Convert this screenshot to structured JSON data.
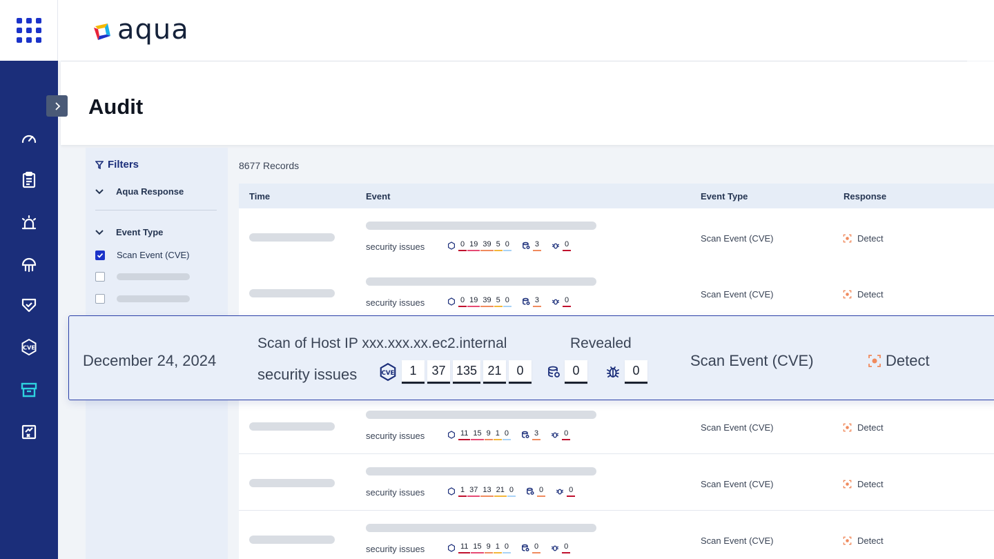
{
  "brand": {
    "name": "aqua"
  },
  "page": {
    "title": "Audit"
  },
  "nav": {
    "items": [
      {
        "name": "dashboard-icon"
      },
      {
        "name": "clipboard-icon"
      },
      {
        "name": "alarm-icon"
      },
      {
        "name": "jellyfish-icon"
      },
      {
        "name": "shield-check-icon"
      },
      {
        "name": "cve-icon"
      },
      {
        "name": "audit-icon",
        "active": true
      },
      {
        "name": "report-icon"
      }
    ],
    "active_color": "#2ed3e0",
    "color": "#ffffff",
    "background": "#1b2e7a"
  },
  "filters": {
    "title": "Filters",
    "groups": [
      {
        "label": "Aqua Response"
      },
      {
        "label": "Event Type"
      }
    ],
    "options": [
      {
        "label": "Scan Event (CVE)",
        "checked": true
      }
    ]
  },
  "records": {
    "count_label": "8677 Records"
  },
  "table": {
    "headers": {
      "time": "Time",
      "event": "Event",
      "event_type": "Event Type",
      "response": "Response"
    },
    "rows": [
      {
        "security_label": "security issues",
        "cve": [
          "0",
          "19",
          "39",
          "5",
          "0"
        ],
        "db": "3",
        "bug": "0",
        "event_type": "Scan Event (CVE)",
        "response": "Detect"
      },
      {
        "security_label": "security issues",
        "cve": [
          "0",
          "19",
          "39",
          "5",
          "0"
        ],
        "db": "3",
        "bug": "0",
        "event_type": "Scan Event (CVE)",
        "response": "Detect"
      },
      {
        "security_label": "security issues",
        "cve": [
          "11",
          "15",
          "9",
          "1",
          "0"
        ],
        "db": "3",
        "bug": "0",
        "event_type": "Scan Event (CVE)",
        "response": "Detect"
      },
      {
        "security_label": "security issues",
        "cve": [
          "1",
          "37",
          "13",
          "21",
          "0"
        ],
        "db": "0",
        "bug": "0",
        "event_type": "Scan Event (CVE)",
        "response": "Detect"
      },
      {
        "security_label": "security issues",
        "cve": [
          "11",
          "15",
          "9",
          "1",
          "0"
        ],
        "db": "0",
        "bug": "0",
        "event_type": "Scan Event (CVE)",
        "response": "Detect"
      }
    ]
  },
  "highlight": {
    "date": "December 24, 2024",
    "scan_text": "Scan of Host IP xxx.xxx.xx.ec2.internal",
    "revealed": "Revealed",
    "security_label": "security issues",
    "cve": [
      "1",
      "37",
      "135",
      "21",
      "0"
    ],
    "db": "0",
    "bug": "0",
    "event_type": "Scan Event (CVE)",
    "response": "Detect"
  },
  "severity_colors": {
    "critical": "#c0102d",
    "high": "#e64a73",
    "medium": "#f08a5d",
    "low": "#f4b73a",
    "negligible": "#a9d2f5"
  }
}
